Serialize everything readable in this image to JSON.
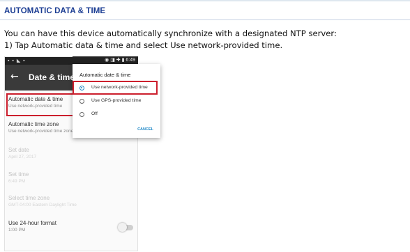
{
  "heading": "AUTOMATIC DATA & TIME",
  "instructions": [
    "You can have this device automatically synchronize with a designated NTP server:",
    "1) Tap Automatic data & time and select Use network-provided time."
  ],
  "phone": {
    "status_left": "▪ ▪ ◣ ▪",
    "status_right": "◉ ◨ ✚ ▮ 6:49",
    "screen_title": "Date & time",
    "settings": [
      {
        "title": "Automatic date & time",
        "subtitle": "Use network-provided time"
      },
      {
        "title": "Automatic time zone",
        "subtitle": "Use network-provided time zone"
      },
      {
        "title": "Set date",
        "subtitle": "April 27, 2017",
        "enabled": false
      },
      {
        "title": "Set time",
        "subtitle": "6:49 PM",
        "enabled": false
      },
      {
        "title": "Select time zone",
        "subtitle": "GMT-04:00 Eastern Daylight Time",
        "enabled": false
      },
      {
        "title": "Use 24-hour format",
        "subtitle": "1:00 PM"
      }
    ],
    "dialog": {
      "title": "Automatic date & time",
      "options": [
        "Use network-provided time",
        "Use GPS-provided time",
        "Off"
      ],
      "selected_index": 0,
      "cancel_label": "CANCEL"
    },
    "toggle_24h_on": false
  },
  "colors": {
    "heading": "#1b3d93",
    "highlight": "#cc1f2d",
    "accent": "#1e88c7"
  }
}
